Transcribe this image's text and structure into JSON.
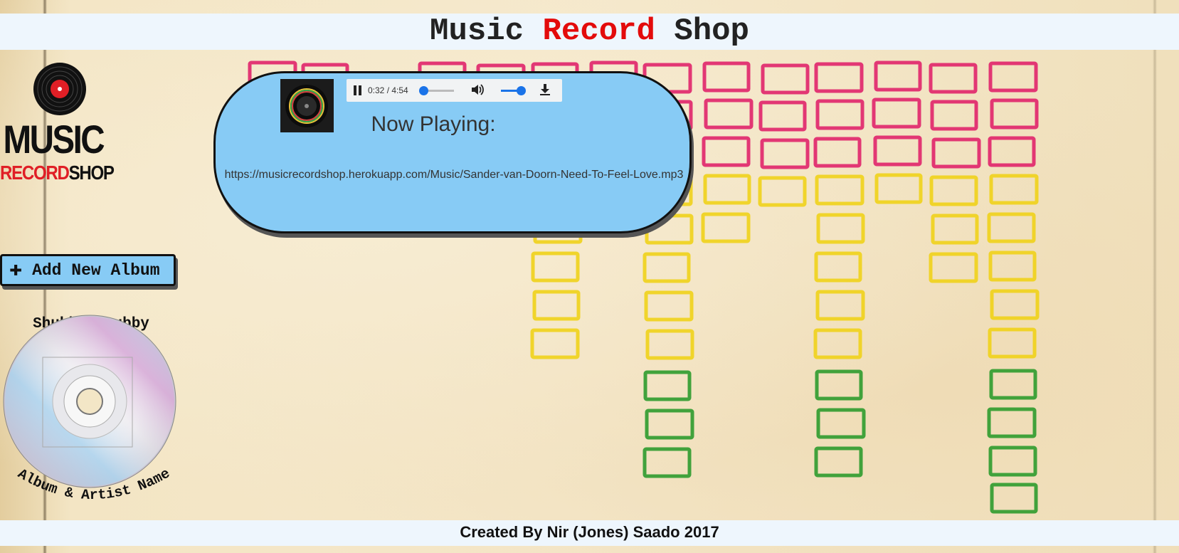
{
  "header": {
    "title_part1": "Music ",
    "title_part2": "Record",
    "title_part3": " Shop"
  },
  "logo": {
    "line1": "MUSIC",
    "line2_red": "RECORD",
    "line2_black": "SHOP"
  },
  "sidebar": {
    "add_album_label": "Add New Album",
    "album": {
      "title": "Shubby, Dubby",
      "caption": "Album & Artist Name"
    }
  },
  "player": {
    "current_time": "0:32",
    "duration": "4:54",
    "progress_fraction": 0.11,
    "volume_fraction": 1.0,
    "now_playing_label": "Now Playing:",
    "track_url": "https://musicrecordshop.herokuapp.com/Music/Sander-van-Doorn-Need-To-Feel-Love.mp3"
  },
  "footer": {
    "credit": "Created By Nir (Jones) Saado 2017"
  },
  "icons": {
    "add": "plus-icon",
    "pause": "pause-icon",
    "volume": "speaker-icon",
    "download": "download-icon"
  },
  "colors": {
    "accent_red": "#e30b0b",
    "button_blue": "#87cbf5",
    "bar_blue": "#eef6fd"
  }
}
